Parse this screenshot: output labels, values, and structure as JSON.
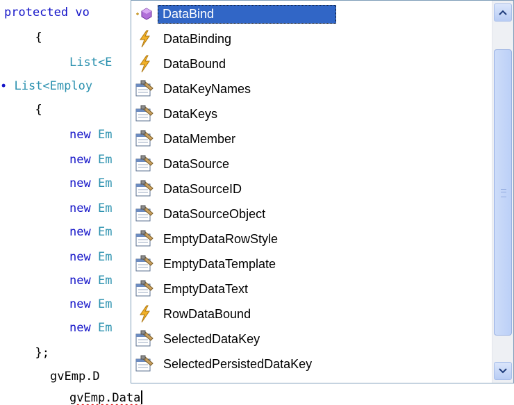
{
  "code": {
    "lines": {
      "l1_kw": "protected",
      "l1_rest": " vo",
      "l2": "  {",
      "l3_type": "List<E",
      "l4_mark": "∙ ",
      "l4_type": "List<Employ",
      "l5": "  {",
      "new_kw": "new",
      "new_type": "Em",
      "l15": "  };",
      "l16": "gvEmp.D",
      "l17": "gvEmp.Data"
    }
  },
  "intellisense": {
    "items": [
      {
        "label": "DataBind",
        "icon": "method-icon",
        "selected": true
      },
      {
        "label": "DataBinding",
        "icon": "event-icon"
      },
      {
        "label": "DataBound",
        "icon": "event-icon"
      },
      {
        "label": "DataKeyNames",
        "icon": "property-icon"
      },
      {
        "label": "DataKeys",
        "icon": "property-icon"
      },
      {
        "label": "DataMember",
        "icon": "property-icon"
      },
      {
        "label": "DataSource",
        "icon": "property-icon"
      },
      {
        "label": "DataSourceID",
        "icon": "property-icon"
      },
      {
        "label": "DataSourceObject",
        "icon": "property-icon"
      },
      {
        "label": "EmptyDataRowStyle",
        "icon": "property-icon"
      },
      {
        "label": "EmptyDataTemplate",
        "icon": "property-icon"
      },
      {
        "label": "EmptyDataText",
        "icon": "property-icon"
      },
      {
        "label": "RowDataBound",
        "icon": "event-icon"
      },
      {
        "label": "SelectedDataKey",
        "icon": "property-icon"
      },
      {
        "label": "SelectedPersistedDataKey",
        "icon": "property-icon"
      }
    ]
  },
  "colors": {
    "keyword": "#1414c8",
    "type": "#2b91af",
    "selection": "#3166c6",
    "event": "#e8a317",
    "method": "#9b59b6"
  }
}
